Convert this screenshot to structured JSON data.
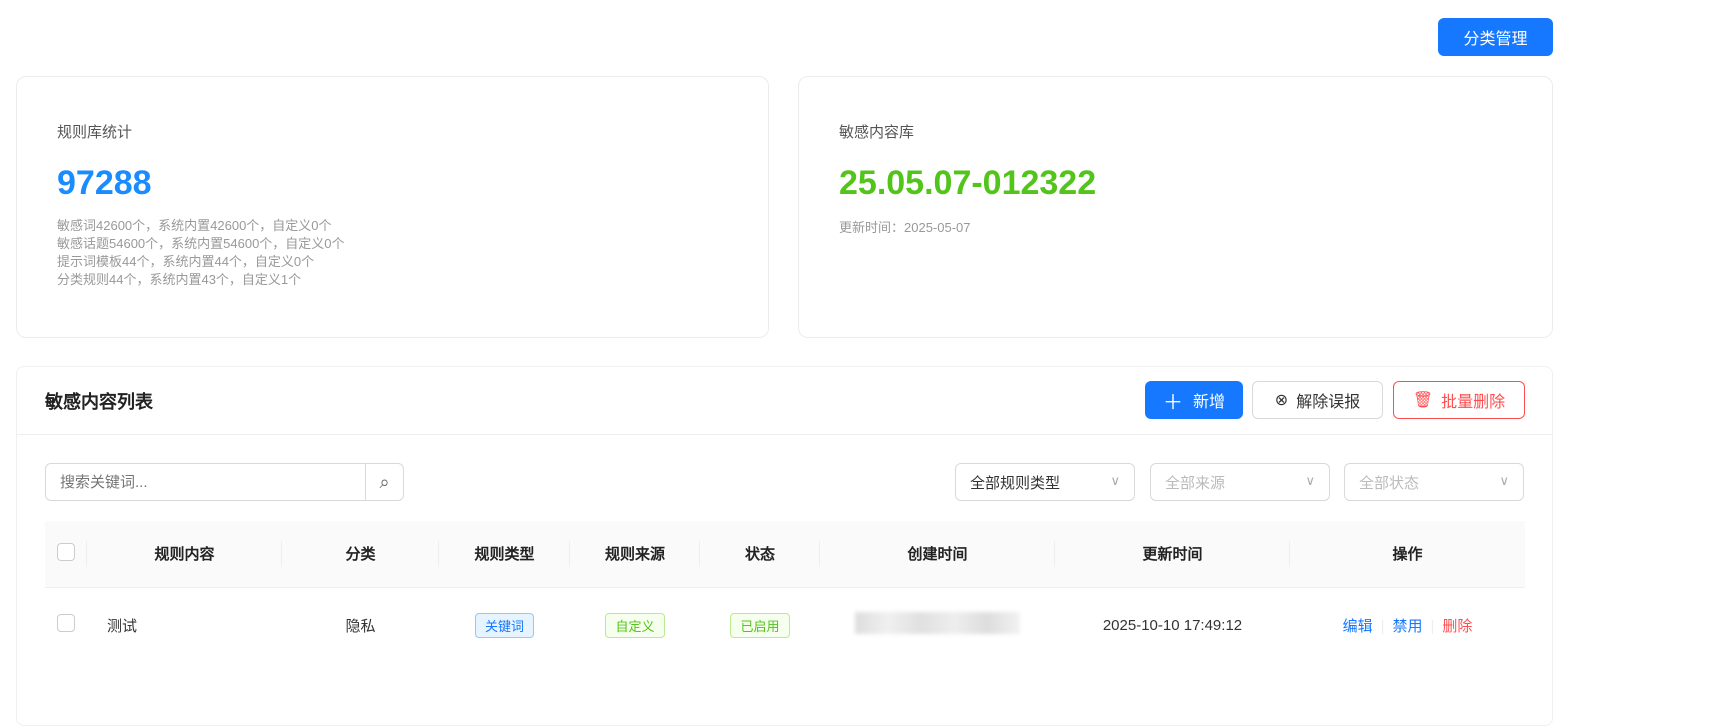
{
  "header": {
    "category_button": "分类管理"
  },
  "stats_card": {
    "title": "规则库统计",
    "total": "97288",
    "lines": [
      "敏感词42600个，系统内置42600个，自定义0个",
      "敏感话题54600个，系统内置54600个，自定义0个",
      "提示词模板44个，系统内置44个，自定义0个",
      "分类规则44个，系统内置43个，自定义1个"
    ]
  },
  "library_card": {
    "title": "敏感内容库",
    "version": "25.05.07-012322",
    "updated": "更新时间：2025-05-07"
  },
  "list": {
    "title": "敏感内容列表",
    "add": "新增",
    "unflag": "解除误报",
    "batch_delete": "批量删除",
    "search_placeholder": "搜索关键词...",
    "filters": [
      "全部规则类型",
      "全部来源",
      "全部状态"
    ],
    "columns": [
      "规则内容",
      "分类",
      "规则类型",
      "规则来源",
      "状态",
      "创建时间",
      "更新时间",
      "操作"
    ],
    "rows": [
      {
        "content": "测试",
        "category": "隐私",
        "type": "关键词",
        "source": "自定义",
        "status": "已启用",
        "updated": "2025-10-10 17:49:12",
        "actions": [
          "编辑",
          "禁用",
          "删除"
        ]
      }
    ]
  },
  "colors": {
    "primary": "#1677ff",
    "green": "#52c41a",
    "danger": "#ff4d4f"
  }
}
